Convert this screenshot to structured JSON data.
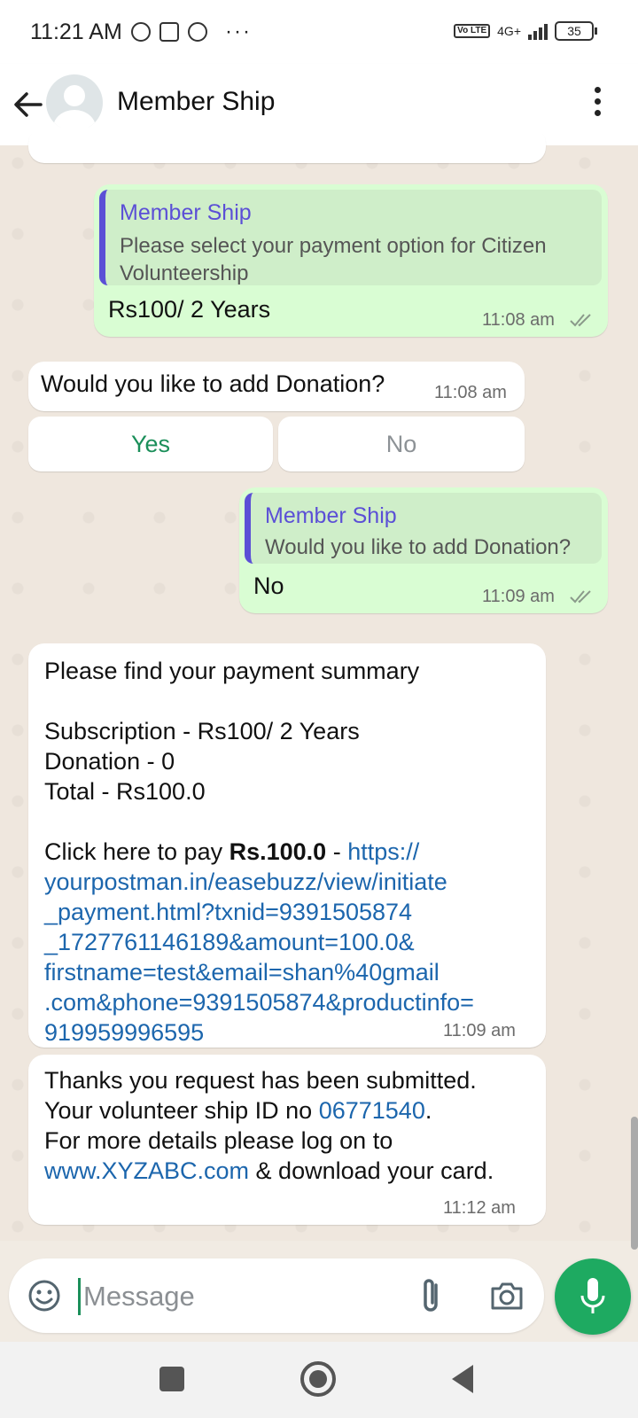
{
  "status_bar": {
    "time": "11:21 AM",
    "more": "···",
    "volte": "Vo LTE",
    "network": "4G+",
    "battery": "35"
  },
  "header": {
    "title": "Member Ship"
  },
  "messages": [
    {
      "quote_title": "Member Ship",
      "quote_text": "Please select your payment option for Citizen Volunteership",
      "text": "Rs100/ 2 Years",
      "time": "11:08 am"
    },
    {
      "text": "Would you like to add Donation?",
      "time": "11:08 am",
      "buttons": {
        "yes": "Yes",
        "no": "No"
      }
    },
    {
      "quote_title": "Member Ship",
      "quote_text": "Would you like to add Donation?",
      "text": "No",
      "time": "11:09 am"
    },
    {
      "line1": "Please find your payment summary",
      "line2": "Subscription - Rs100/ 2 Years",
      "line3": "Donation - 0",
      "line4": "Total - Rs100.0",
      "pay_prefix": "Click here to pay ",
      "pay_amount": "Rs.100.0",
      "pay_sep": " - ",
      "link_lines": [
        "https://",
        "yourpostman.in/easebuzz/view/initiate",
        "_payment.html?txnid=9391505874",
        "_1727761146189&amount=100.0&",
        "firstname=test&email=shan%40gmail",
        ".com&phone=9391505874&productinfo=",
        "919959996595"
      ],
      "time": "11:09 am"
    },
    {
      "line1": "Thanks you request has been submitted.",
      "line2_prefix": "Your volunteer ship ID no ",
      "line2_id": "06771540",
      "line2_suffix": ".",
      "line3": "For more details please log on to",
      "line4_link": "www.XYZABC.com",
      "line4_suffix": " & download your card.",
      "time": "11:12 am"
    }
  ],
  "composer": {
    "placeholder": "Message"
  },
  "colors": {
    "outgoing_bubble": "#d9fdd3",
    "incoming_bubble": "#ffffff",
    "accent_green": "#1eaa61",
    "quote_bar": "#5b4fd6",
    "link": "#1c66ad"
  }
}
